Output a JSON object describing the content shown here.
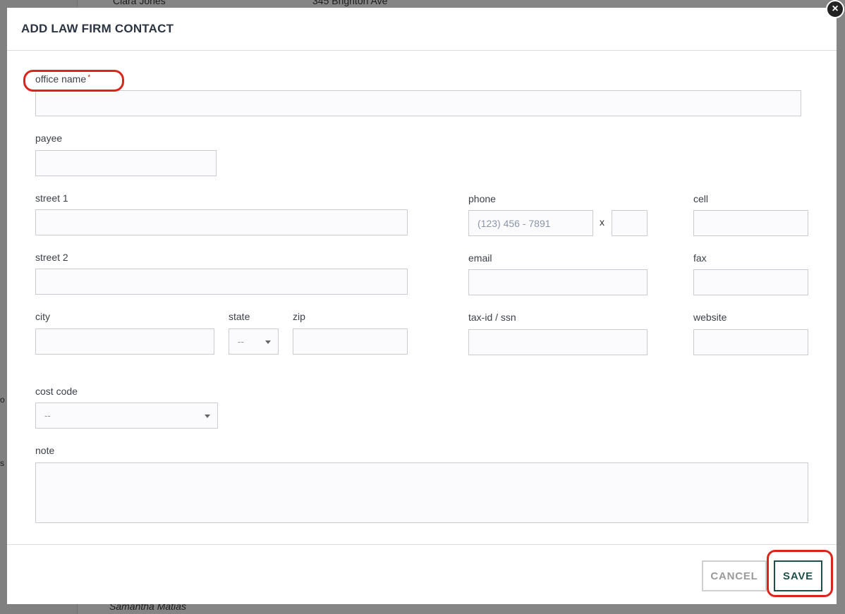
{
  "background": {
    "row_top_name": "Clara Jones",
    "row_top_address": "345 Brighton Ave",
    "row_bottom_name": "Samantha Matias",
    "sidebar_fragment_1": "o",
    "sidebar_fragment_2": "s"
  },
  "modal": {
    "title": "ADD LAW FIRM CONTACT",
    "close_glyph": "×"
  },
  "form": {
    "office_name": {
      "label": "office name",
      "required_mark": "*",
      "value": ""
    },
    "payee": {
      "label": "payee",
      "value": ""
    },
    "street1": {
      "label": "street 1",
      "value": ""
    },
    "street2": {
      "label": "street 2",
      "value": ""
    },
    "city": {
      "label": "city",
      "value": ""
    },
    "state": {
      "label": "state",
      "selected": "--"
    },
    "zip": {
      "label": "zip",
      "value": ""
    },
    "phone": {
      "label": "phone",
      "placeholder": "(123) 456 - 7891",
      "ext_separator": "x"
    },
    "cell": {
      "label": "cell",
      "value": ""
    },
    "email": {
      "label": "email",
      "value": ""
    },
    "fax": {
      "label": "fax",
      "value": ""
    },
    "tax_id": {
      "label": "tax-id / ssn",
      "value": ""
    },
    "website": {
      "label": "website",
      "value": ""
    },
    "cost_code": {
      "label": "cost code",
      "selected": "--"
    },
    "note": {
      "label": "note",
      "value": ""
    }
  },
  "footer": {
    "cancel_label": "CANCEL",
    "save_label": "SAVE"
  },
  "colors": {
    "highlight": "#d9261c",
    "save_accent": "#1e4f4a"
  }
}
